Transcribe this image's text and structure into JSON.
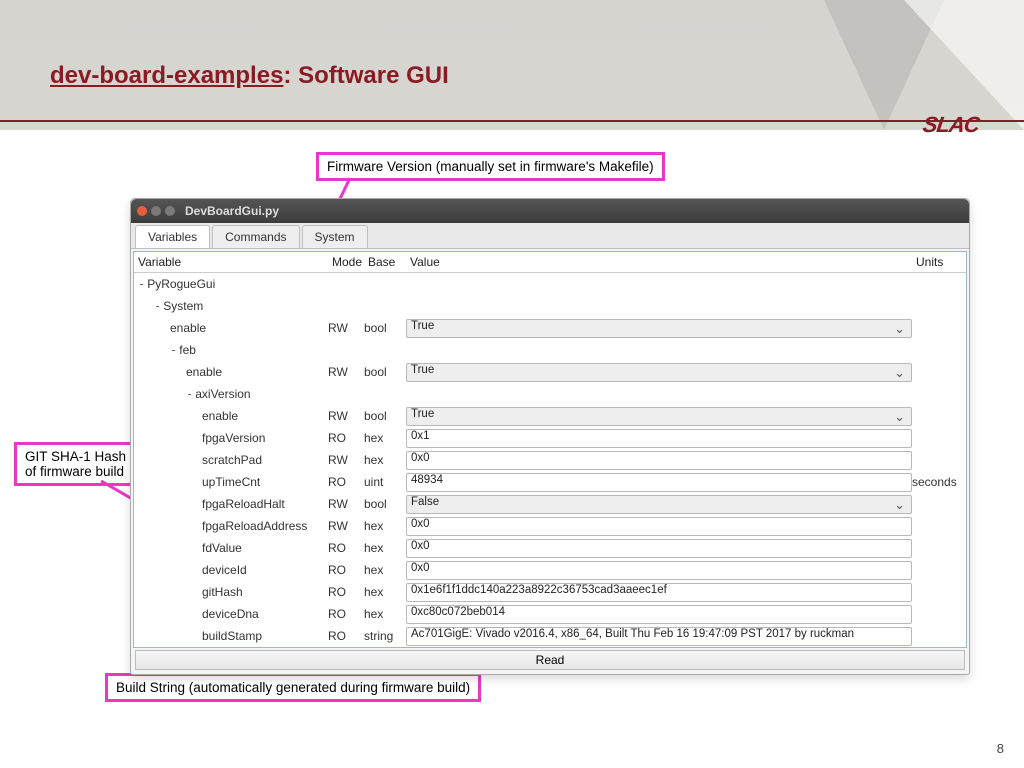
{
  "slide": {
    "title_underlined": "dev-board-examples",
    "title_rest": ": Software GUI",
    "logo": "SLAC",
    "page": "8"
  },
  "callouts": {
    "fw": "Firmware Version (manually set in firmware's Makefile)",
    "git": "GIT SHA-1 Hash at the time of firmware build",
    "build": "Build String (automatically generated during firmware build)"
  },
  "window": {
    "title": "DevBoardGui.py"
  },
  "tabs": [
    "Variables",
    "Commands",
    "System"
  ],
  "columns": {
    "var": "Variable",
    "mode": "Mode",
    "base": "Base",
    "value": "Value",
    "units": "Units"
  },
  "tree": {
    "root": "PyRogueGui",
    "sys": "System",
    "feb": "feb",
    "axi": "axiVersion",
    "sys_enable": "enable",
    "feb_enable": "enable",
    "rows": [
      {
        "name": "enable",
        "mode": "RW",
        "base": "bool",
        "value": "True",
        "combo": true
      },
      {
        "name": "fpgaVersion",
        "mode": "RO",
        "base": "hex",
        "value": "0x1"
      },
      {
        "name": "scratchPad",
        "mode": "RW",
        "base": "hex",
        "value": "0x0"
      },
      {
        "name": "upTimeCnt",
        "mode": "RO",
        "base": "uint",
        "value": "48934",
        "units": "seconds"
      },
      {
        "name": "fpgaReloadHalt",
        "mode": "RW",
        "base": "bool",
        "value": "False",
        "combo": true
      },
      {
        "name": "fpgaReloadAddress",
        "mode": "RW",
        "base": "hex",
        "value": "0x0"
      },
      {
        "name": "fdValue",
        "mode": "RO",
        "base": "hex",
        "value": "0x0"
      },
      {
        "name": "deviceId",
        "mode": "RO",
        "base": "hex",
        "value": "0x0"
      },
      {
        "name": "gitHash",
        "mode": "RO",
        "base": "hex",
        "value": "0x1e6f1f1ddc140a223a8922c36753cad3aaeec1ef"
      },
      {
        "name": "deviceDna",
        "mode": "RO",
        "base": "hex",
        "value": "0xc80c072beb014"
      },
      {
        "name": "buildStamp",
        "mode": "RO",
        "base": "string",
        "value": "Ac701GigE: Vivado v2016.4, x86_64, Built Thu Feb 16 19:47:09 PST 2017 by ruckman"
      }
    ],
    "sys_enable_row": {
      "mode": "RW",
      "base": "bool",
      "value": "True"
    },
    "feb_enable_row": {
      "mode": "RW",
      "base": "bool",
      "value": "True"
    }
  },
  "read_button": "Read"
}
